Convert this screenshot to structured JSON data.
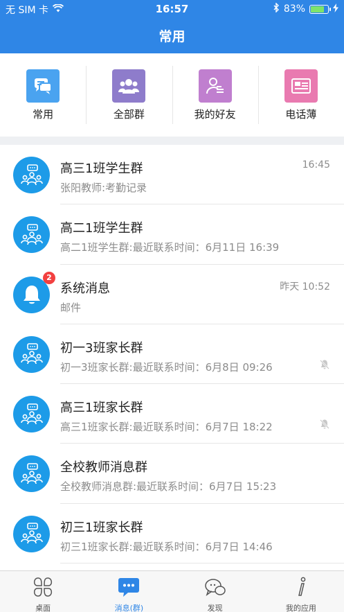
{
  "status_bar": {
    "carrier": "无 SIM 卡",
    "time": "16:57",
    "battery": "83%",
    "battery_level": 0.83,
    "icons": [
      "wifi-icon",
      "bluetooth-icon",
      "battery-icon",
      "charging-icon"
    ]
  },
  "header": {
    "title": "常用"
  },
  "quick_entries": [
    {
      "label": "常用",
      "icon": "chat-bubbles-icon",
      "color": "#4aa3f0"
    },
    {
      "label": "全部群",
      "icon": "group-icon",
      "color": "#8e7ccb"
    },
    {
      "label": "我的好友",
      "icon": "friend-icon",
      "color": "#c07fcf"
    },
    {
      "label": "电话薄",
      "icon": "contact-card-icon",
      "color": "#e97ab0"
    }
  ],
  "conversations": [
    {
      "title": "高三1班学生群",
      "subtitle": "张阳教师:考勤记录",
      "time": "16:45",
      "icon": "group-chat-icon",
      "muted": false
    },
    {
      "title": "高二1班学生群",
      "subtitle": "高二1班学生群:最近联系时间：6月11日 16:39",
      "time": "",
      "icon": "group-chat-icon",
      "muted": false
    },
    {
      "title": "系统消息",
      "subtitle": "邮件",
      "time": "昨天 10:52",
      "icon": "bell-icon",
      "badge": "2",
      "muted": false
    },
    {
      "title": "初一3班家长群",
      "subtitle": "初一3班家长群:最近联系时间：6月8日 09:26",
      "time": "",
      "icon": "group-chat-icon",
      "muted": true
    },
    {
      "title": "高三1班家长群",
      "subtitle": "高三1班家长群:最近联系时间：6月7日 18:22",
      "time": "",
      "icon": "group-chat-icon",
      "muted": true
    },
    {
      "title": "全校教师消息群",
      "subtitle": "全校教师消息群:最近联系时间：6月7日 15:23",
      "time": "",
      "icon": "group-chat-icon",
      "muted": false
    },
    {
      "title": "初三1班家长群",
      "subtitle": "初三1班家长群:最近联系时间：6月7日 14:46",
      "time": "",
      "icon": "group-chat-icon",
      "muted": false
    }
  ],
  "tabs": [
    {
      "label": "桌面",
      "icon": "desktop-grid-icon",
      "active": false
    },
    {
      "label": "消息(群)",
      "icon": "message-icon",
      "active": true
    },
    {
      "label": "发现",
      "icon": "discover-icon",
      "active": false
    },
    {
      "label": "我的应用",
      "icon": "info-icon",
      "active": false
    }
  ],
  "colors": {
    "primary": "#2f86e6",
    "avatar": "#1d9be8",
    "badge": "#f24040",
    "battery": "#7ee36b"
  }
}
